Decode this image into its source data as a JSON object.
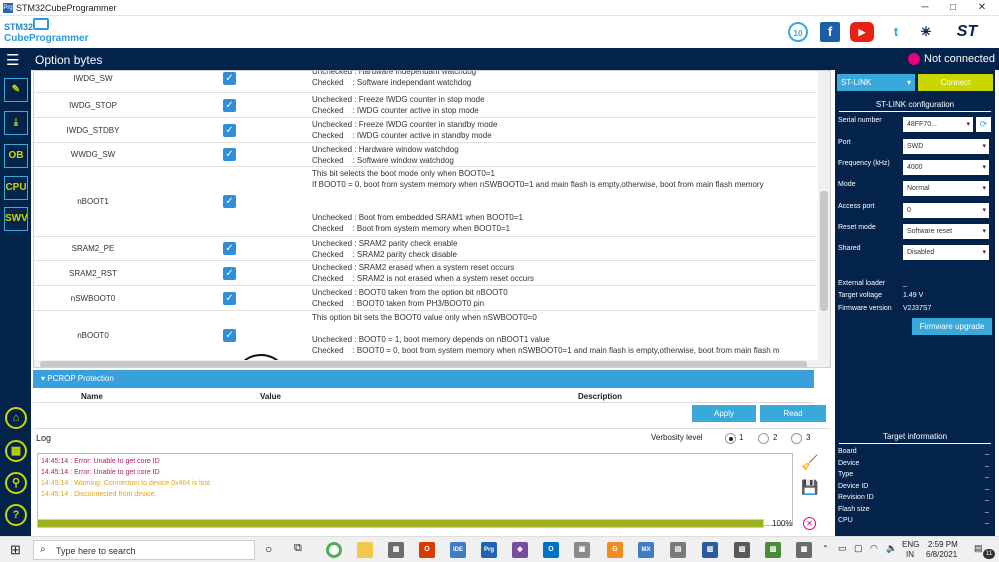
{
  "app": {
    "title": "STM32CubeProgrammer",
    "logo_line1": "STM32",
    "logo_line2": "CubeProgrammer"
  },
  "header": {
    "title": "Option bytes",
    "status": "Not connected"
  },
  "sidebar": {
    "items": [
      "edit-icon",
      "download-icon",
      "OB",
      "CPU",
      "SWV"
    ]
  },
  "rows": [
    {
      "name": "IWDG_SW",
      "checked": true,
      "desc": "Unchecked : Hardware independant watchdog\nChecked    : Software independant watchdog"
    },
    {
      "name": "IWDG_STOP",
      "checked": true,
      "desc": "Unchecked : Freeze IWDG counter in stop mode\nChecked    : IWDG counter active in stop mode"
    },
    {
      "name": "IWDG_STDBY",
      "checked": true,
      "desc": "Unchecked : Freeze IWDG counter in standby mode\nChecked    : IWDG counter active in standby mode"
    },
    {
      "name": "WWDG_SW",
      "checked": true,
      "desc": "Unchecked : Hardware window watchdog\nChecked    : Software window watchdog"
    },
    {
      "name": "nBOOT1",
      "checked": true,
      "desc": "This bit selects the boot mode only when BOOT0=1\nIf BOOT0 = 0, boot from system memory when nSWBOOT0=1 and main flash is empty,otherwise, boot from main flash memory\n\n\nUnchecked : Boot from embedded SRAM1 when BOOT0=1\nChecked    : Boot from system memory when BOOT0=1"
    },
    {
      "name": "SRAM2_PE",
      "checked": true,
      "desc": "Unchecked : SRAM2 parity check enable\nChecked    : SRAM2 parity check disable"
    },
    {
      "name": "SRAM2_RST",
      "checked": true,
      "desc": "Unchecked : SRAM2 erased when a system reset occurs\nChecked    : SRAM2 is not erased when a system reset occurs"
    },
    {
      "name": "nSWBOOT0",
      "checked": true,
      "desc": "Unchecked : BOOT0 taken from the option bit nBOOT0\nChecked    : BOOT0 taken from PH3/BOOT0 pin"
    },
    {
      "name": "nBOOT0",
      "checked": true,
      "desc": "This option bit sets the BOOT0 value only when nSWBOOT0=0\n\nUnchecked : BOOT0 = 1, boot memory depends on nBOOT1 value\nChecked    : BOOT0 = 0, boot from system memory when nSWBOOT0=1 and main flash is empty,otherwise, boot from main flash m"
    }
  ],
  "pcrop": {
    "title": "PCROP Protection",
    "col_name": "Name",
    "col_value": "Value",
    "col_desc": "Description"
  },
  "buttons": {
    "apply": "Apply",
    "read": "Read"
  },
  "log": {
    "title": "Log",
    "verbosity_label": "Verbosity level",
    "levels": [
      "1",
      "2",
      "3"
    ],
    "selected_level": "1",
    "lines": [
      {
        "text": "14:45:14 : Error: Unable to get core ID",
        "color": "#b0206b"
      },
      {
        "text": "14:45:14 : Error: Unable to get core ID",
        "color": "#b0206b"
      },
      {
        "text": "14:45:14 : Warning: Connection to device 0x464 is lost",
        "color": "#e8a317"
      },
      {
        "text": "14:45:14 : Disconnected from device.",
        "color": "#e8a317"
      }
    ]
  },
  "progress": {
    "percent_label": "100%",
    "value": 1.0
  },
  "stlink": {
    "interface": "ST-LINK",
    "connect_label": "Connect",
    "config_title": "ST-LINK configuration",
    "fields": [
      {
        "label": "Serial number",
        "value": "48FF70..."
      },
      {
        "label": "Port",
        "value": "SWD"
      },
      {
        "label": "Frequency (kHz)",
        "value": "4000"
      },
      {
        "label": "Mode",
        "value": "Normal"
      },
      {
        "label": "Access port",
        "value": "0"
      },
      {
        "label": "Reset mode",
        "value": "Software reset"
      },
      {
        "label": "Shared",
        "value": "Disabled"
      }
    ],
    "external_loader_label": "External loader",
    "external_loader_value": "_",
    "target_voltage_label": "Target voltage",
    "target_voltage": "1.49 V",
    "firmware_label": "Firmware version",
    "firmware": "V2J37S7",
    "firmware_upgrade": "Firmware upgrade"
  },
  "target": {
    "title": "Target information",
    "fields": [
      {
        "label": "Board",
        "value": "_"
      },
      {
        "label": "Device",
        "value": "_"
      },
      {
        "label": "Type",
        "value": "_"
      },
      {
        "label": "Device ID",
        "value": "_"
      },
      {
        "label": "Revision ID",
        "value": "_"
      },
      {
        "label": "Flash size",
        "value": "_"
      },
      {
        "label": "CPU",
        "value": "_"
      }
    ]
  },
  "taskbar": {
    "search_placeholder": "Type here to search",
    "lang": "ENG",
    "region": "IN",
    "time": "2:59 PM",
    "date": "6/8/2021",
    "notif_count": "11"
  },
  "colors": {
    "navy": "#03234b",
    "accent": "#39a9dc",
    "lime": "#c9d600",
    "magenta": "#e6007e"
  }
}
